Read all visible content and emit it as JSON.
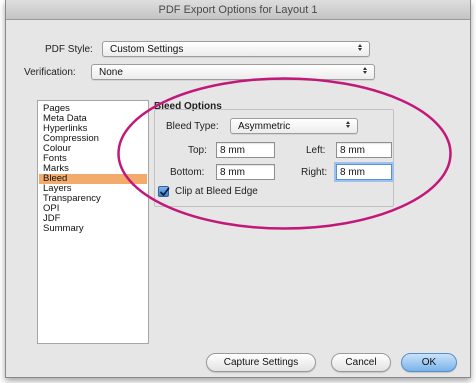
{
  "window": {
    "title": "PDF Export Options for Layout 1"
  },
  "pdf_style": {
    "label": "PDF Style:",
    "value": "Custom Settings"
  },
  "verification": {
    "label": "Verification:",
    "value": "None"
  },
  "sidebar": {
    "items": [
      {
        "label": "Pages",
        "selected": false
      },
      {
        "label": "Meta Data",
        "selected": false
      },
      {
        "label": "Hyperlinks",
        "selected": false
      },
      {
        "label": "Compression",
        "selected": false
      },
      {
        "label": "Colour",
        "selected": false
      },
      {
        "label": "Fonts",
        "selected": false
      },
      {
        "label": "Marks",
        "selected": false
      },
      {
        "label": "Bleed",
        "selected": true
      },
      {
        "label": "Layers",
        "selected": false
      },
      {
        "label": "Transparency",
        "selected": false
      },
      {
        "label": "OPI",
        "selected": false
      },
      {
        "label": "JDF",
        "selected": false
      },
      {
        "label": "Summary",
        "selected": false
      }
    ]
  },
  "bleed_options": {
    "heading": "Bleed Options",
    "type_label": "Bleed Type:",
    "type_value": "Asymmetric",
    "top_label": "Top:",
    "top_value": "8 mm",
    "bottom_label": "Bottom:",
    "bottom_value": "8 mm",
    "left_label": "Left:",
    "left_value": "8 mm",
    "right_label": "Right:",
    "right_value": "8 mm",
    "clip_label": "Clip at Bleed Edge",
    "clip_checked": true
  },
  "buttons": {
    "capture": "Capture Settings",
    "cancel": "Cancel",
    "ok": "OK"
  },
  "colors": {
    "selection": "#f2ab6b",
    "highlight_ellipse": "#c2187a",
    "default_button": "#79b3ea"
  }
}
